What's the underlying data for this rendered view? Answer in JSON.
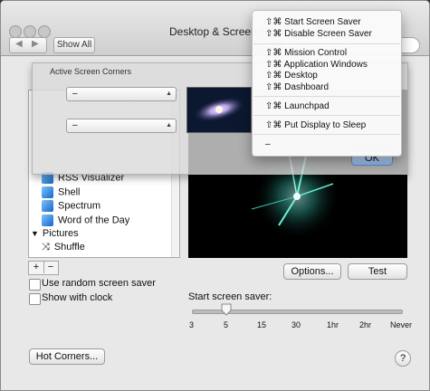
{
  "window": {
    "title": "Desktop & Screen Saver",
    "show_all": "Show All"
  },
  "list": {
    "items": [
      {
        "label": "RSS Visualizer",
        "icon": "screen-saver-icon"
      },
      {
        "label": "Shell",
        "icon": "screen-saver-icon"
      },
      {
        "label": "Spectrum",
        "icon": "screen-saver-icon"
      },
      {
        "label": "Word of the Day",
        "icon": "screen-saver-icon"
      },
      {
        "label": "Pictures",
        "icon": "disclosure-triangle-icon"
      },
      {
        "label": "Shuffle",
        "icon": "shuffle-icon"
      }
    ]
  },
  "buttons": {
    "plus": "+",
    "minus": "−",
    "options": "Options...",
    "test": "Test",
    "hot_corners": "Hot Corners...",
    "help": "?",
    "ok": "OK"
  },
  "checkboxes": {
    "random": "Use random screen saver",
    "clock": "Show with clock"
  },
  "slider": {
    "label": "Start screen saver:",
    "ticks": [
      "3",
      "5",
      "15",
      "30",
      "1hr",
      "2hr",
      "Never"
    ],
    "selected": "5"
  },
  "sheet": {
    "title": "Active Screen Corners",
    "top_left": "–",
    "bottom_left": "–"
  },
  "menu": {
    "items": [
      {
        "label": "⇧⌘ Start Screen Saver"
      },
      {
        "label": "⇧⌘ Disable Screen Saver"
      },
      {
        "label": "⇧⌘ Mission Control"
      },
      {
        "label": "⇧⌘ Application Windows"
      },
      {
        "label": "⇧⌘ Desktop"
      },
      {
        "label": "⇧⌘ Dashboard"
      },
      {
        "label": "⇧⌘ Launchpad"
      },
      {
        "label": "⇧⌘ Put Display to Sleep"
      },
      {
        "label": "–"
      }
    ]
  },
  "colors": {
    "accent": "#3a87e0",
    "ok_button": "#8fb7ec",
    "preview_glow": "#5ff0dc"
  }
}
